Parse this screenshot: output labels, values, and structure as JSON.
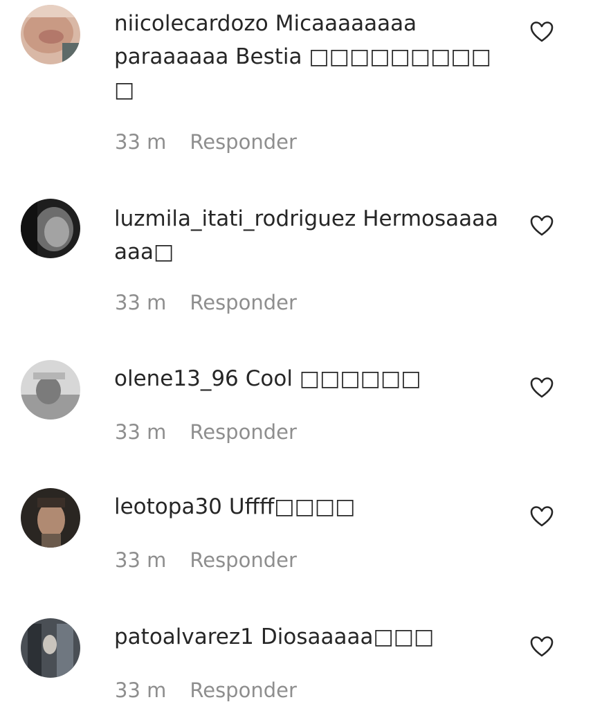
{
  "comments": [
    {
      "username": "niicolecardozo",
      "text": "Micaaaaaaaa paraaaaaa Bestia □□□□□□□□□ □",
      "time": "33 m",
      "reply_label": "Responder",
      "like_icon": "heart-outline-icon"
    },
    {
      "username": "luzmila_itati_rodriguez",
      "text": "Hermosaaaaaaa□",
      "time": "33 m",
      "reply_label": "Responder",
      "like_icon": "heart-outline-icon"
    },
    {
      "username": "olene13_96",
      "text": "Cool □□□□□□",
      "time": "33 m",
      "reply_label": "Responder",
      "like_icon": "heart-outline-icon"
    },
    {
      "username": "leotopa30",
      "text": "Uffff□□□□",
      "time": "33 m",
      "reply_label": "Responder",
      "like_icon": "heart-outline-icon"
    },
    {
      "username": "patoalvarez1",
      "text": "Diosaaaaa□□□",
      "time": "33 m",
      "reply_label": "Responder",
      "like_icon": "heart-outline-icon"
    }
  ],
  "colors": {
    "text": "#262626",
    "meta": "#8e8e8e",
    "background": "#ffffff"
  }
}
